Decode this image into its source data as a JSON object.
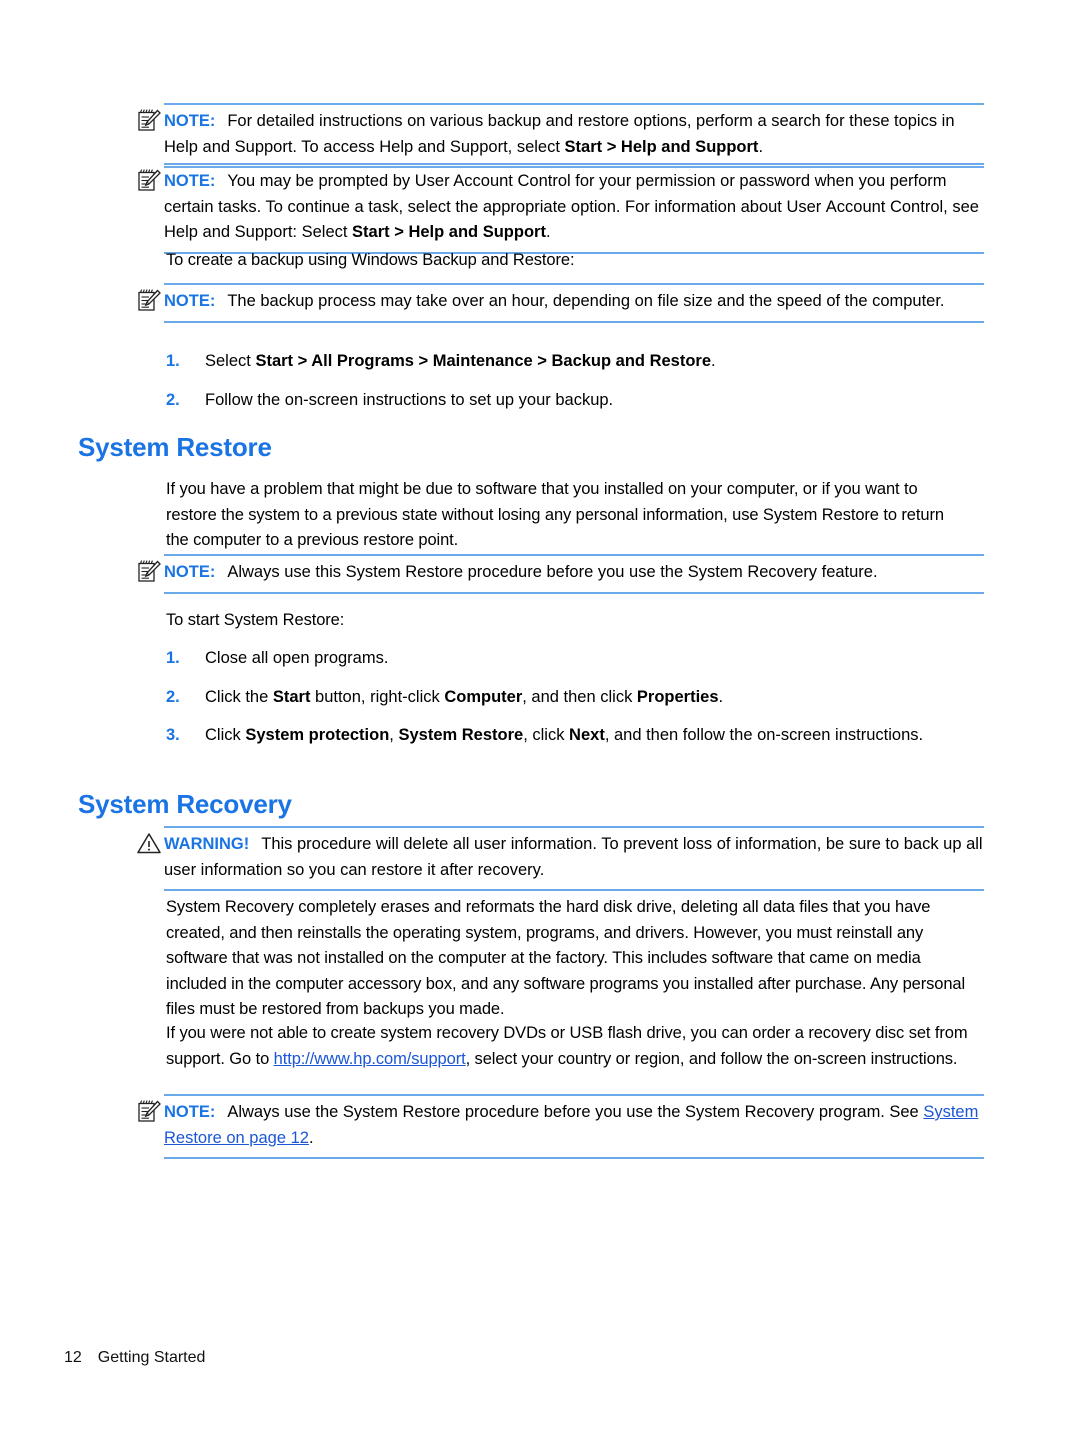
{
  "document": {
    "type": "user-guide-page",
    "accent_blue": "#1b74e4",
    "rule_blue": "#6aa9ea",
    "link_blue": "#1b56d6",
    "background": "#ffffff"
  },
  "notes": {
    "label": "NOTE:",
    "warning_label": "WARNING!",
    "icon_note": "note-pad-pencil-icon",
    "icon_warning": "warning-triangle-icon"
  },
  "note1": {
    "label": "NOTE:",
    "line1_a": "For detailed instructions on various backup and restore options, perform a search for these",
    "line2_a": "topics in Help and Support. To access Help and Support, select ",
    "line2_b": "Start > Help and Support",
    "line2_c": "."
  },
  "note2": {
    "label": "NOTE:",
    "line1": "You may be prompted by User Account Control for your permission or password when you",
    "line2": "perform certain tasks. To continue a task, select the appropriate option. For information about User",
    "line3_a": "Account Control, see Help and Support: Select ",
    "line3_b": "Start > Help and Support",
    "line3_c": "."
  },
  "intro_backup": {
    "text": "To create a backup using Windows Backup and Restore:"
  },
  "note3": {
    "label": "NOTE:",
    "line1": "The backup process may take over an hour, depending on file size and the speed of the",
    "line2": "computer."
  },
  "backup_steps": {
    "items": [
      {
        "num": "1.",
        "prefix": "Select ",
        "bold": "Start > All Programs > Maintenance > Backup and Restore",
        "suffix": "."
      },
      {
        "num": "2.",
        "prefix": "Follow the on-screen instructions to set up your backup.",
        "bold": "",
        "suffix": ""
      }
    ]
  },
  "system_restore": {
    "heading": "System Restore",
    "paragraph": "If you have a problem that might be due to software that you installed on your computer, or if you want to restore the system to a previous state without losing any personal information, use System Restore to return the computer to a previous restore point.",
    "note": {
      "label": "NOTE:",
      "text": "Always use this System Restore procedure before you use the System Recovery feature."
    },
    "intro": "To start System Restore:",
    "steps": [
      {
        "num": "1.",
        "segments": [
          {
            "text": "Close all open programs.",
            "bold": false
          }
        ]
      },
      {
        "num": "2.",
        "segments": [
          {
            "text": "Click the ",
            "bold": false
          },
          {
            "text": "Start",
            "bold": true
          },
          {
            "text": " button, right-click ",
            "bold": false
          },
          {
            "text": "Computer",
            "bold": true
          },
          {
            "text": ", and then click ",
            "bold": false
          },
          {
            "text": "Properties",
            "bold": true
          },
          {
            "text": ".",
            "bold": false
          }
        ]
      },
      {
        "num": "3.",
        "segments": [
          {
            "text": "Click ",
            "bold": false
          },
          {
            "text": "System protection",
            "bold": true
          },
          {
            "text": ", ",
            "bold": false
          },
          {
            "text": "System Restore",
            "bold": true
          },
          {
            "text": ", click ",
            "bold": false
          },
          {
            "text": "Next",
            "bold": true
          },
          {
            "text": ", and then follow the on-screen instructions.",
            "bold": false
          }
        ]
      }
    ]
  },
  "system_recovery": {
    "heading": "System Recovery",
    "warning": {
      "label": "WARNING!",
      "line1": "This procedure will delete all user information. To prevent loss of information, be sure",
      "line2": "to back up all user information so you can restore it after recovery."
    },
    "paragraph": "System Recovery completely erases and reformats the hard disk drive, deleting all data files that you have created, and then reinstalls the operating system, programs, and drivers. However, you must reinstall any software that was not installed on the computer at the factory. This includes software that came on media included in the computer accessory box, and any software programs you installed after purchase. Any personal files must be restored from backups you made.",
    "paragraph2_a": "If you were not able to create system recovery DVDs or USB flash drive, you can order a recovery disc set from support. Go to ",
    "paragraph2_link": "http://www.hp.com/support",
    "paragraph2_b": ", select your country or region, and follow the on-screen instructions.",
    "note": {
      "label": "NOTE:",
      "line1": "Always use the System Restore procedure before you use the System Recovery program.",
      "line2_a": "See ",
      "line2_link": "System Restore on page 12",
      "line2_b": "."
    }
  },
  "footer": {
    "page_number": "12",
    "section_title": "Getting Started"
  }
}
